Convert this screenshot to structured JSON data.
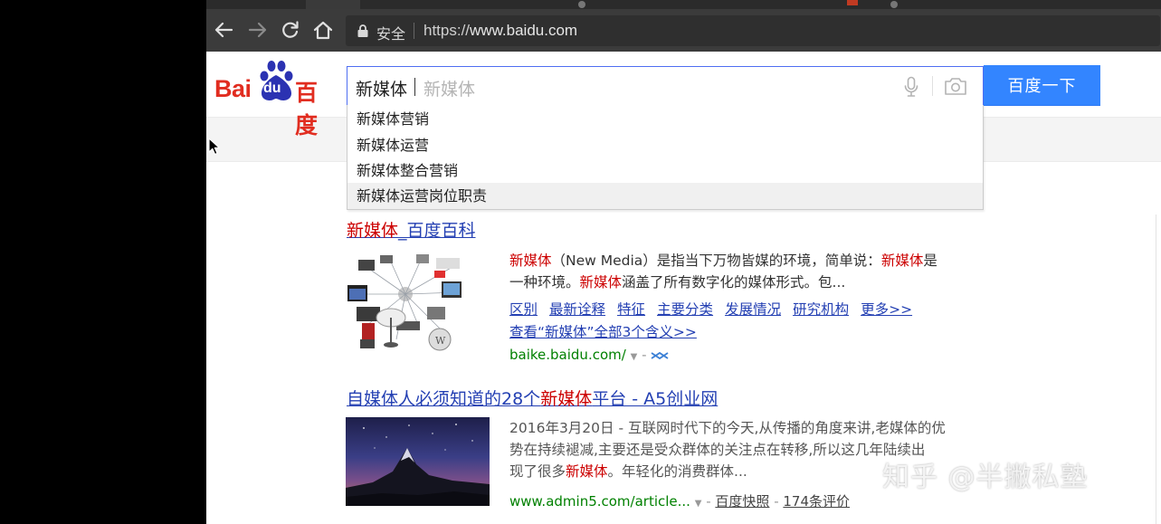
{
  "browser": {
    "secure_label": "安全",
    "url_protocol": "https://",
    "url_host": "www.baidu.com"
  },
  "logo": {
    "bai": "Bai",
    "du": "du",
    "cn": "百度"
  },
  "search": {
    "typed": "新媒体",
    "ghost": "新媒体",
    "button_label": "百度一下",
    "suggestions": [
      "新媒体营销",
      "新媒体运营",
      "新媒体整合营销",
      "新媒体运营岗位职责"
    ]
  },
  "results": [
    {
      "title_hl": "新媒体",
      "title_rest": "_百度百科",
      "text": {
        "part1_hl": "新媒体",
        "part1": "（New Media）是指当下万物皆媒的环境，简单说：",
        "part2_hl": "新媒体",
        "part2": "是",
        "line2a": "一种环境。",
        "line2_hl": "新媒体",
        "line2b": "涵盖了所有数字化的媒体形式。包..."
      },
      "links": [
        "区别",
        "最新诠释",
        "特征",
        "主要分类",
        "发展情况",
        "研究机构",
        "更多>>"
      ],
      "more_meanings": "查看“新媒体”全部3个含义>>",
      "url": "baike.baidu.com/"
    },
    {
      "title_a": "自媒体人必须知道的28个",
      "title_hl": "新媒体",
      "title_b": "平台 - A5创业网",
      "line1": "2016年3月20日 - 互联网时代下的今天,从传播的角度来讲,老媒体的优",
      "line2": "势在持续褪减,主要还是受众群体的关注点在转移,所以这几年陆续出",
      "line3a": "现了很多",
      "line3_hl": "新媒体",
      "line3b": "。年轻化的消费群体...",
      "url": "www.admin5.com/article...",
      "snapshot": "百度快照",
      "reviews": "174条评价"
    }
  ],
  "watermark": "知乎 @半撇私塾",
  "colors": {
    "baidu_red": "#e12d20",
    "baidu_blue": "#3385ff",
    "link_blue": "#2440b3",
    "highlight_red": "#cc0000",
    "url_green": "#008000"
  }
}
